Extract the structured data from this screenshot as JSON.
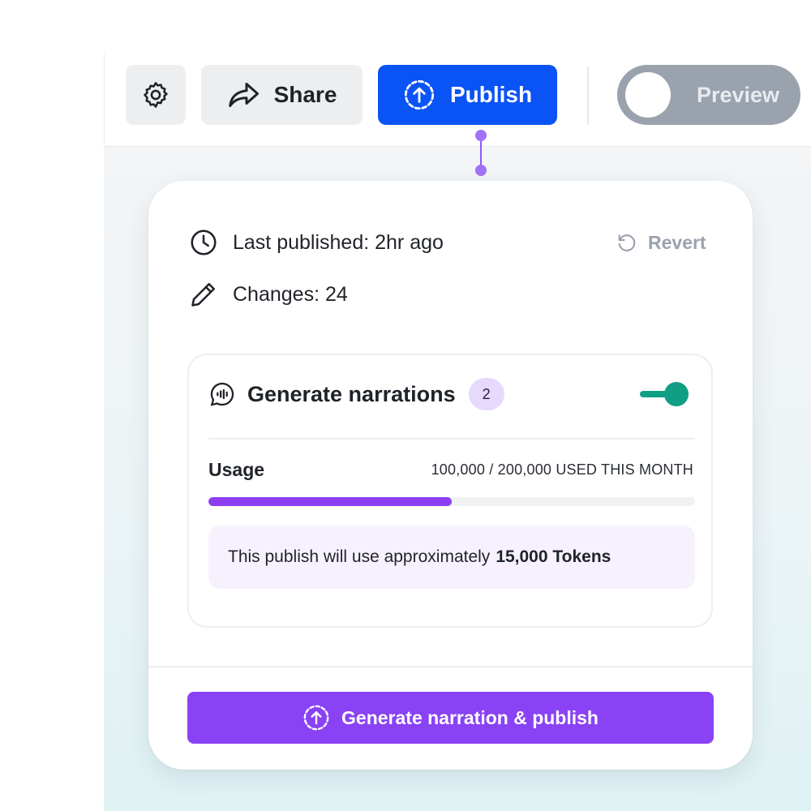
{
  "toolbar": {
    "settings_icon": "gear-icon",
    "share_label": "Share",
    "share_icon": "share-arrow-icon",
    "publish_label": "Publish",
    "publish_icon": "upload-circle-icon",
    "preview_label": "Preview",
    "preview_enabled": false
  },
  "publish_panel": {
    "last_published": "Last published: 2hr ago",
    "changes": "Changes: 24",
    "revert_label": "Revert",
    "narrations": {
      "title": "Generate narrations",
      "count": "2",
      "enabled": true,
      "usage_label": "Usage",
      "usage_text": "100,000 / 200,000 USED THIS MONTH",
      "usage_used": 100000,
      "usage_total": 200000,
      "token_note_prefix": "This publish will use approximately",
      "token_note_amount": "15,000 Tokens"
    },
    "cta_label": "Generate narration & publish"
  },
  "colors": {
    "publish_blue": "#0a53f5",
    "accent_purple": "#8a42f5",
    "toggle_green": "#109e84",
    "badge_lavender": "#e6d9fc",
    "preview_gray": "#9aa2ad"
  }
}
